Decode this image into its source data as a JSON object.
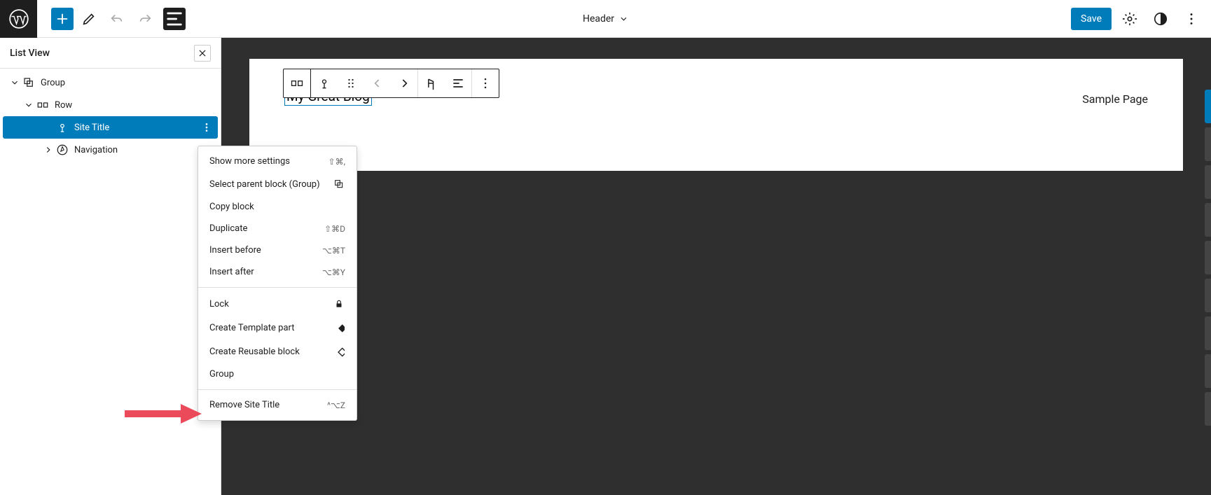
{
  "top": {
    "template_name": "Header",
    "save_label": "Save"
  },
  "panel": {
    "title": "List View"
  },
  "tree": {
    "group_label": "Group",
    "row_label": "Row",
    "site_title_label": "Site Title",
    "navigation_label": "Navigation"
  },
  "canvas": {
    "site_title_text": "My Great Blog",
    "nav_link_text": "Sample Page"
  },
  "ctx": {
    "show_more": "Show more settings",
    "show_more_sc": "⇧⌘,",
    "select_parent": "Select parent block (Group)",
    "copy_block": "Copy block",
    "duplicate": "Duplicate",
    "duplicate_sc": "⇧⌘D",
    "insert_before": "Insert before",
    "insert_before_sc": "⌥⌘T",
    "insert_after": "Insert after",
    "insert_after_sc": "⌥⌘Y",
    "lock": "Lock",
    "create_template": "Create Template part",
    "create_reusable": "Create Reusable block",
    "group": "Group",
    "remove": "Remove Site Title",
    "remove_sc": "^⌥Z"
  }
}
